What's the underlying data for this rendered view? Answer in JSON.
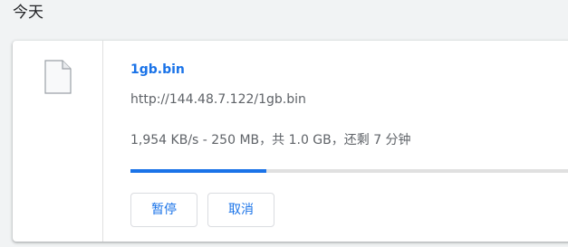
{
  "section": {
    "date_label": "今天"
  },
  "download": {
    "file_name": "1gb.bin",
    "url": "http://144.48.7.122/1gb.bin",
    "status": "1,954 KB/s - 250 MB，共 1.0 GB，还剩 7 分钟",
    "progress_fraction": 0.3,
    "buttons": {
      "pause_label": "暂停",
      "cancel_label": "取消"
    }
  },
  "colors": {
    "accent": "#1a73e8",
    "progress_track": "#e0e0e0",
    "background": "#f1f3f4"
  },
  "icons": {
    "file": "file-icon"
  }
}
